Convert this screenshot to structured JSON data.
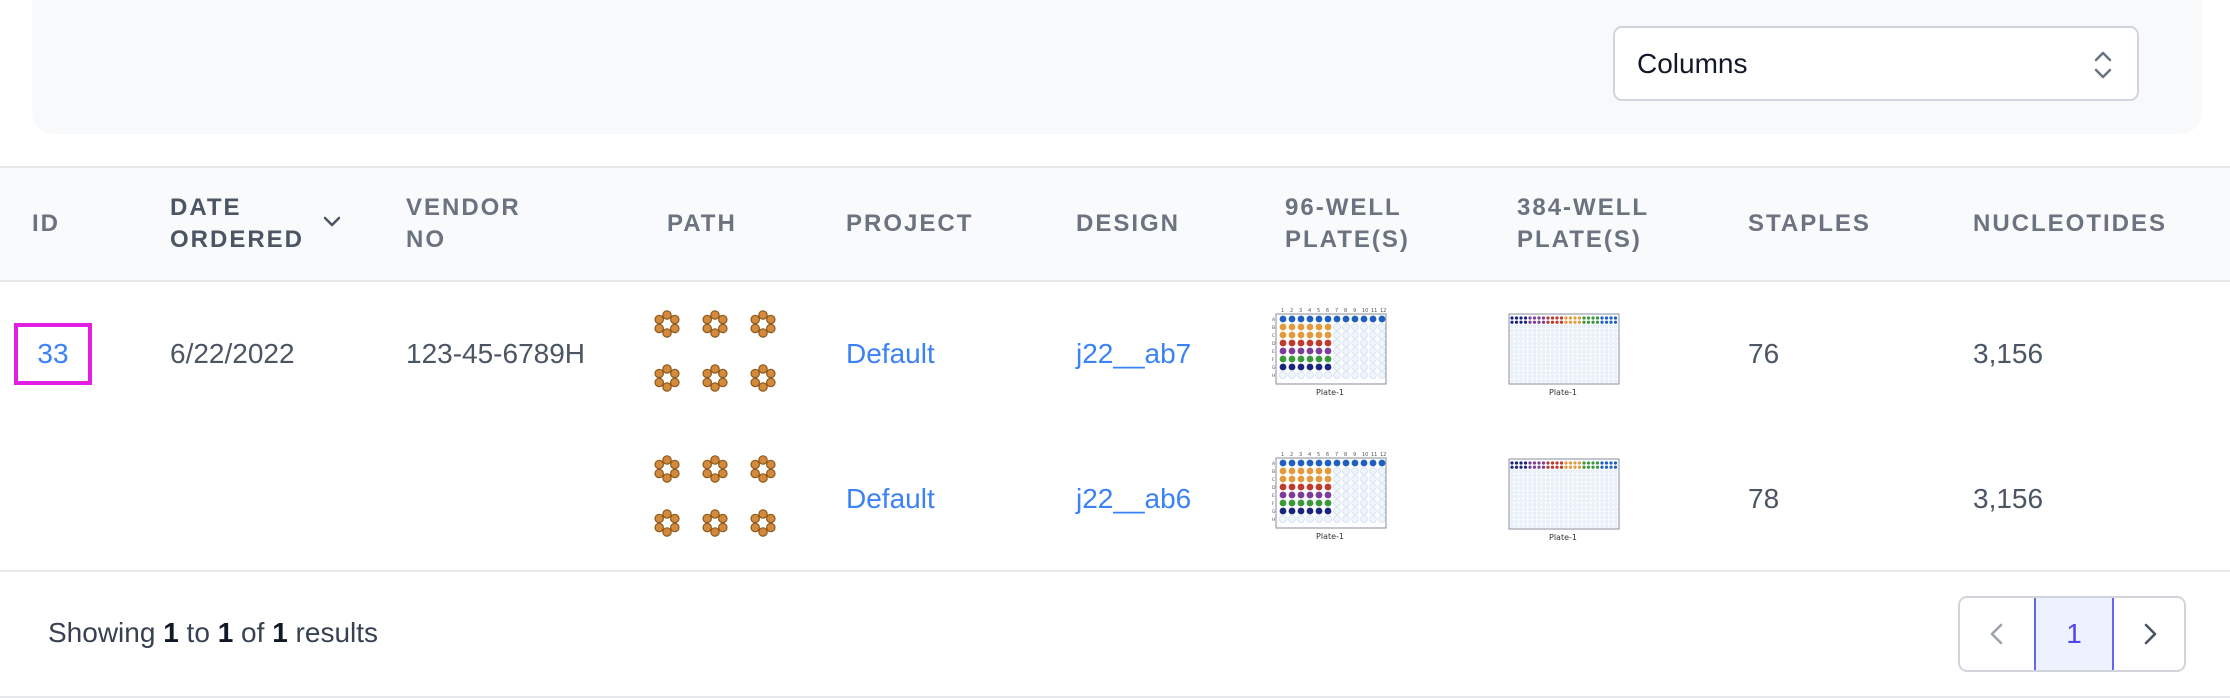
{
  "toolbar": {
    "columns_select": {
      "value": "Columns",
      "icon": "chevron-up-down-icon"
    }
  },
  "table": {
    "headers": {
      "id": "ID",
      "date_ordered": [
        "DATE",
        "ORDERED"
      ],
      "vendor_no": [
        "VENDOR",
        "NO"
      ],
      "path": "PATH",
      "project": "PROJECT",
      "design": "DESIGN",
      "plates96": [
        "96-WELL",
        "PLATE(S)"
      ],
      "plates384": [
        "384-WELL",
        "PLATE(S)"
      ],
      "staples": "STAPLES",
      "nucleotides": "NUCLEOTIDES"
    },
    "sort_icon": "chevron-down-icon",
    "order": {
      "id": "33",
      "date_ordered": "6/22/2022",
      "vendor_no": "123-45-6789H"
    },
    "rows": [
      {
        "project": "Default",
        "design": "j22__ab7",
        "staples": "76",
        "nucleotides": "3,156",
        "plate_label": "Plate-1"
      },
      {
        "project": "Default",
        "design": "j22__ab6",
        "staples": "78",
        "nucleotides": "3,156",
        "plate_label": "Plate-1"
      }
    ],
    "plate96_col_numbers": [
      "1",
      "2",
      "3",
      "4",
      "5",
      "6",
      "7",
      "8",
      "9",
      "10",
      "11",
      "12"
    ],
    "plate_row_letters": [
      "A",
      "B",
      "C",
      "D",
      "E",
      "F",
      "G",
      "H"
    ]
  },
  "footer": {
    "showing_prefix": "Showing",
    "from": "1",
    "to_word": "to",
    "to": "1",
    "of_word": "of",
    "total": "1",
    "results_word": "results"
  },
  "pagination": {
    "current_page": "1",
    "prev_icon": "chevron-left-icon",
    "next_icon": "chevron-right-icon"
  },
  "colors": {
    "link": "#3b82f6",
    "highlight": "#e11ee1",
    "well_blue": "#1f5fbf",
    "well_orange": "#e39a3b",
    "well_red": "#c0392b",
    "well_purple": "#7d3c98",
    "well_green": "#3a9a3a",
    "well_navy": "#1a237e"
  }
}
